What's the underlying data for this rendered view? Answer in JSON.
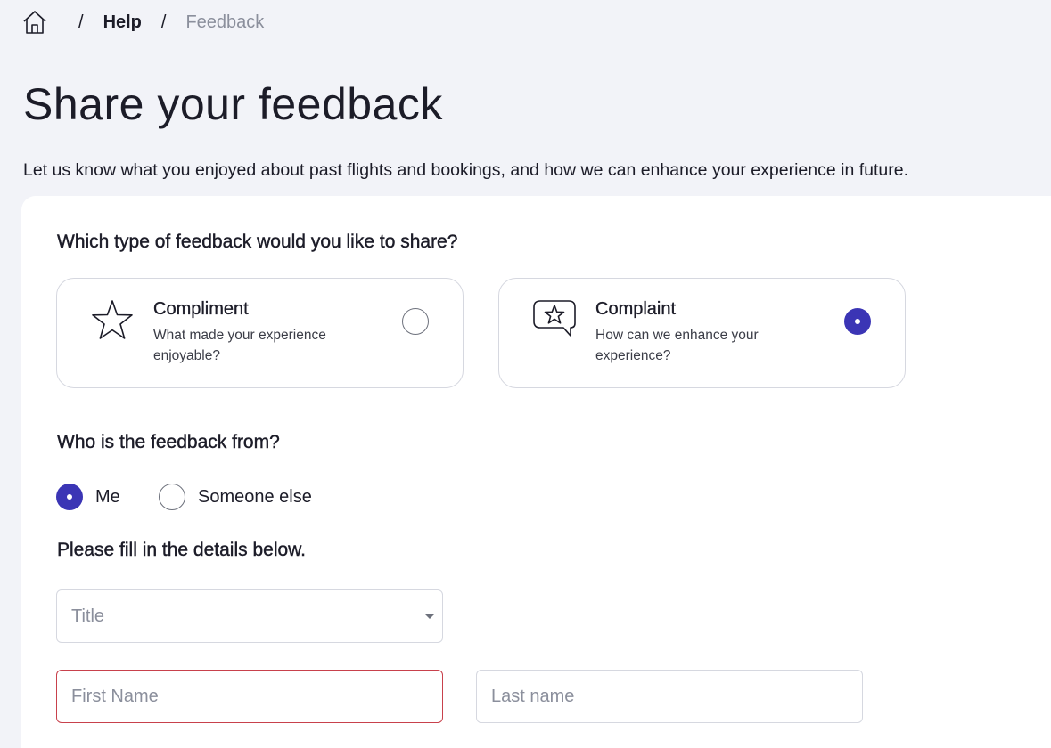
{
  "breadcrumb": {
    "home_icon": "home-icon",
    "separator": "/",
    "help_label": "Help",
    "current_label": "Feedback"
  },
  "page": {
    "title": "Share your feedback",
    "intro": "Let us know what you enjoyed about past flights and bookings, and how we can enhance your experience in future."
  },
  "feedback_type": {
    "heading": "Which type of feedback would you like to share?",
    "options": [
      {
        "icon": "star-icon",
        "title": "Compliment",
        "description": "What made your experience enjoyable?",
        "selected": false
      },
      {
        "icon": "speech-bubble-star-icon",
        "title": "Complaint",
        "description": "How can we enhance your experience?",
        "selected": true
      }
    ]
  },
  "feedback_from": {
    "heading": "Who is the feedback from?",
    "options": [
      {
        "label": "Me",
        "selected": true
      },
      {
        "label": "Someone else",
        "selected": false
      }
    ]
  },
  "details": {
    "heading": "Please fill in the details below.",
    "title_select": {
      "placeholder": "Title",
      "value": ""
    },
    "first_name": {
      "placeholder": "First Name",
      "value": "",
      "error": true
    },
    "last_name": {
      "placeholder": "Last name",
      "value": ""
    }
  },
  "colors": {
    "accent": "#3b35b5",
    "error_border": "#c8414c",
    "page_background": "#f2f3f8"
  }
}
